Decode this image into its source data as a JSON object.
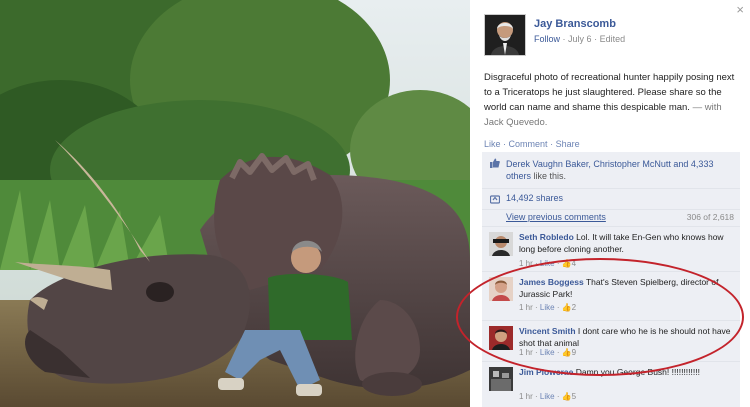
{
  "post": {
    "author": "Jay Branscomb",
    "follow": "Follow",
    "date": "July 6",
    "edited": "Edited",
    "text": "Disgraceful photo of recreational hunter happily posing next to a Triceratops he just slaughtered. Please share so the world can name and shame this despicable man.",
    "with_text": "— with Jack Quevedo."
  },
  "actions": {
    "like": "Like",
    "comment": "Comment",
    "share": "Share"
  },
  "likes": {
    "names": "Derek Vaughn Baker, Christopher McNutt and 4,333 others",
    "suffix": "like this."
  },
  "shares": {
    "text": "14,492 shares"
  },
  "view_previous": {
    "label": "View previous comments",
    "count": "306 of 2,618"
  },
  "comments": [
    {
      "name": "Seth Robledo",
      "text": "Lol. It will take En-Gen who knows how long before cloning another.",
      "time": "1 hr",
      "like": "Like",
      "likes": "4"
    },
    {
      "name": "James Boggess",
      "text": "That's Steven Spielberg, director of Jurassic Park!",
      "time": "1 hr",
      "like": "Like",
      "likes": "2"
    },
    {
      "name": "Vincent Smith",
      "text": "I dont care who he is he should not have shot that animal",
      "time": "1 hr",
      "like": "Like",
      "likes": "9"
    },
    {
      "name": "Jim Plowcrae",
      "text": "Damn you George Bush! !!!!!!!!!!!!",
      "time": "1 hr",
      "like": "Like",
      "likes": "5"
    }
  ],
  "colors": {
    "brand": "#3b5998",
    "annotation": "#c3232b",
    "ufi_bg": "#edeff4"
  },
  "icons": {
    "close": "×",
    "thumb": "thumbs-up-icon",
    "share": "share-icon"
  }
}
